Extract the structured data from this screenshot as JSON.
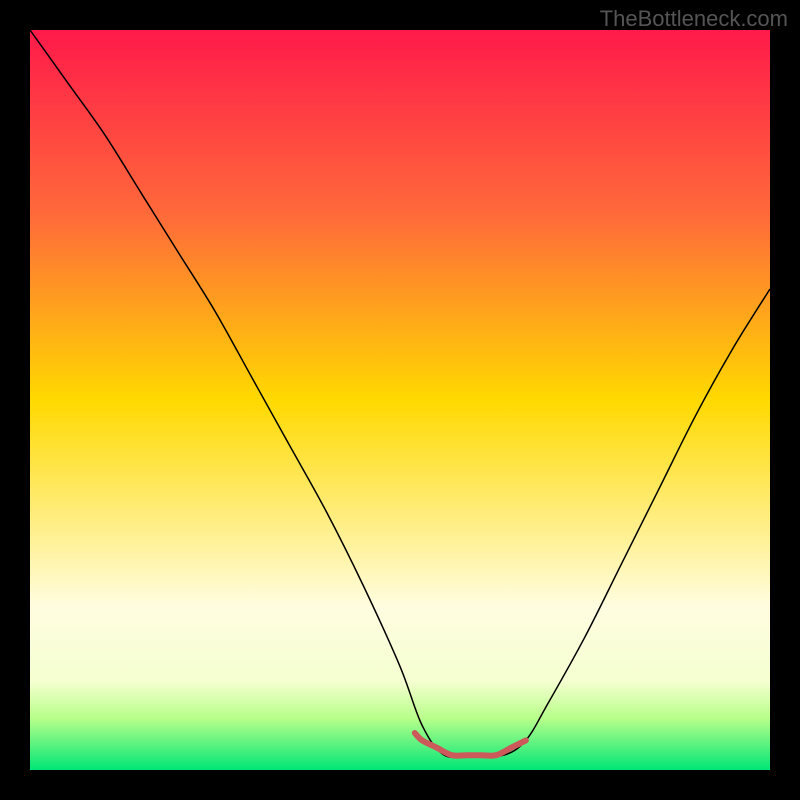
{
  "watermark_text": "TheBottleneck.com",
  "chart_data": {
    "type": "line",
    "title": "",
    "xlabel": "",
    "ylabel": "",
    "xlim": [
      0,
      100
    ],
    "ylim": [
      0,
      100
    ],
    "grid": false,
    "background_gradient": {
      "stops": [
        {
          "offset": 0,
          "color": "#ff1a4a"
        },
        {
          "offset": 0.25,
          "color": "#ff6a3a"
        },
        {
          "offset": 0.5,
          "color": "#ffd900"
        },
        {
          "offset": 0.78,
          "color": "#fffde0"
        },
        {
          "offset": 0.88,
          "color": "#f5ffd0"
        },
        {
          "offset": 0.93,
          "color": "#b8ff8a"
        },
        {
          "offset": 1.0,
          "color": "#00e676"
        }
      ]
    },
    "series": [
      {
        "name": "bottleneck-curve",
        "color": "#000000",
        "width": 1.5,
        "x": [
          0,
          5,
          10,
          15,
          20,
          25,
          30,
          35,
          40,
          45,
          50,
          53,
          56,
          60,
          64,
          67,
          70,
          75,
          80,
          85,
          90,
          95,
          100
        ],
        "values": [
          100,
          93,
          86,
          78,
          70,
          62,
          53,
          44,
          35,
          25,
          14,
          6,
          2,
          2,
          2,
          4,
          9,
          18,
          28,
          38,
          48,
          57,
          65
        ]
      },
      {
        "name": "optimal-segment",
        "color": "#cc5a5a",
        "width": 6,
        "x": [
          52,
          53,
          55,
          57,
          59,
          61,
          63,
          65,
          67
        ],
        "values": [
          5,
          4,
          3,
          2,
          2,
          2,
          2,
          3,
          4
        ]
      }
    ]
  }
}
